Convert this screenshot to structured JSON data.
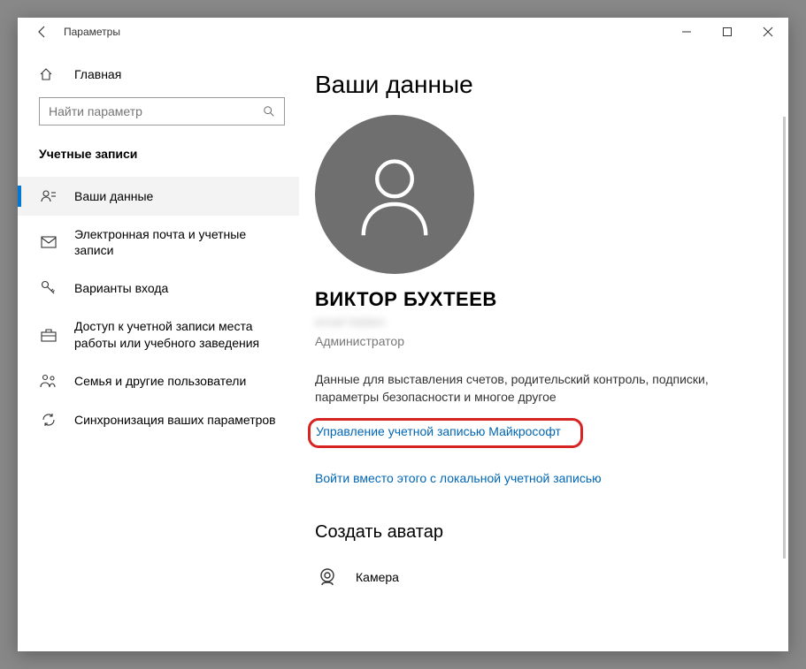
{
  "window": {
    "title": "Параметры"
  },
  "sidebar": {
    "home": "Главная",
    "search_placeholder": "Найти параметр",
    "category": "Учетные записи",
    "items": [
      {
        "label": "Ваши данные",
        "icon": "user-card-icon",
        "active": true
      },
      {
        "label": "Электронная почта и учетные записи",
        "icon": "mail-icon"
      },
      {
        "label": "Варианты входа",
        "icon": "key-icon"
      },
      {
        "label": "Доступ к учетной записи места работы или учебного заведения",
        "icon": "briefcase-icon"
      },
      {
        "label": "Семья и другие пользователи",
        "icon": "family-icon"
      },
      {
        "label": "Синхронизация ваших параметров",
        "icon": "sync-icon"
      }
    ]
  },
  "main": {
    "title": "Ваши данные",
    "user_name": "ВИКТОР БУХТЕЕВ",
    "user_email": "email hidden",
    "user_role": "Администратор",
    "desc": "Данные для выставления счетов, родительский контроль, подписки, параметры безопасности и многое другое",
    "manage_link": "Управление учетной записью Майкрософт",
    "local_link": "Войти вместо этого с локальной учетной записью",
    "avatar_section": "Создать аватар",
    "camera_option": "Камера"
  }
}
